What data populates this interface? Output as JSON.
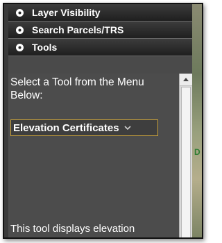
{
  "accordion": {
    "sections": [
      {
        "label": "Layer Visibility"
      },
      {
        "label": "Search Parcels/TRS"
      },
      {
        "label": "Tools"
      }
    ]
  },
  "tools": {
    "instruction": "Select a Tool from the Menu Below:",
    "dropdown_value": "Elevation Certificates",
    "description": "This tool displays elevation"
  },
  "map": {
    "edge_letter": "D"
  },
  "colors": {
    "header_bg": "#1f1f1f",
    "panel_bg": "#4c4c4c",
    "dropdown_border": "#c9a13b"
  },
  "icons": {
    "section_icon": "gear-bullet-icon",
    "dropdown_caret": "chevron-down-icon",
    "scroll_up": "arrow-up-icon"
  }
}
